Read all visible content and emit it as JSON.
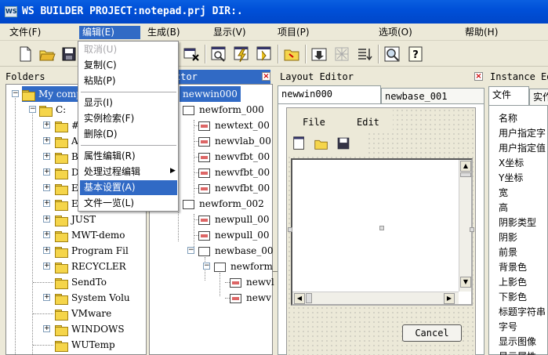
{
  "window": {
    "title": "WS BUILDER PROJECT:notepad.prj DIR:."
  },
  "menubar": {
    "items": [
      "文件(F)",
      "编辑(E)",
      "生成(B)",
      "显示(V)",
      "项目(P)",
      "选项(O)",
      "帮助(H)"
    ],
    "selected": "编辑(E)"
  },
  "edit_menu": {
    "items": [
      {
        "label": "取消(U)",
        "disabled": true
      },
      {
        "label": "复制(C)"
      },
      {
        "label": "粘贴(P)"
      },
      {
        "label": "显示(I)"
      },
      {
        "label": "实例检索(F)"
      },
      {
        "label": "删除(D)"
      },
      {
        "label": "属性编辑(R)"
      },
      {
        "label": "处理过程编辑",
        "submenu": true
      },
      {
        "label": "基本设置(A)",
        "highlighted": true
      },
      {
        "label": "文件一览(L)"
      }
    ]
  },
  "folders_panel": {
    "title": "Folders",
    "items": [
      "My comp",
      "C:",
      "#",
      "A",
      "B",
      "D",
      "E",
      "E",
      "JUST",
      "MWT-demo",
      "Program Fil",
      "RECYCLER",
      "SendTo",
      "System Volu",
      "VMware",
      "WINDOWS",
      "WUTemp"
    ]
  },
  "inspector_panel": {
    "title": "ctor",
    "items": [
      "newwin000",
      "newform_000",
      "newtext_00",
      "newvlab_00",
      "newvfbt_00",
      "newvfbt_00",
      "newvfbt_00",
      "newform_002",
      "newpull_00",
      "newpull_00",
      "newbase_00",
      "newform_",
      "newvl",
      "newv"
    ]
  },
  "layout_editor": {
    "title": "Layout Editor",
    "tabs": [
      "newwin000",
      "newbase_001"
    ],
    "active_tab": "newwin000",
    "form_menu": [
      "File",
      "Edit"
    ],
    "cancel_label": "Cancel"
  },
  "instance_panel": {
    "title": "Instance Ed",
    "tabs": [
      "文件",
      "实作"
    ],
    "properties": [
      "名称",
      "用户指定字",
      "用户指定值",
      "X坐标",
      "Y坐标",
      "宽",
      "高",
      "阴影类型",
      "阴影",
      "前景",
      "背景色",
      "上影色",
      "下影色",
      "标题字符串",
      "字号",
      "显示图像",
      "显示属性"
    ]
  },
  "colors": {
    "title_blue": "#0050d8",
    "menu_highlight": "#316ac5",
    "panel_bg": "#ece9d8"
  }
}
